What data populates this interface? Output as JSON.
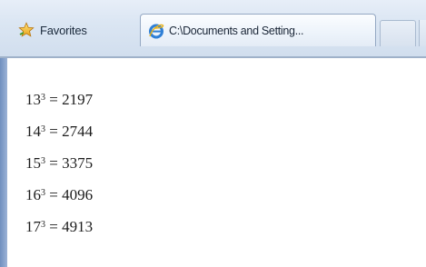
{
  "toolbar": {
    "favorites_label": "Favorites"
  },
  "tab": {
    "title": "C:\\Documents and Setting..."
  },
  "content": {
    "lines": [
      {
        "base": "13",
        "exp": "3",
        "rest": " = 2197"
      },
      {
        "base": "14",
        "exp": "3",
        "rest": " = 2744"
      },
      {
        "base": "15",
        "exp": "3",
        "rest": " = 3375"
      },
      {
        "base": "16",
        "exp": "3",
        "rest": " = 4096"
      },
      {
        "base": "17",
        "exp": "3",
        "rest": " = 4913"
      }
    ]
  }
}
